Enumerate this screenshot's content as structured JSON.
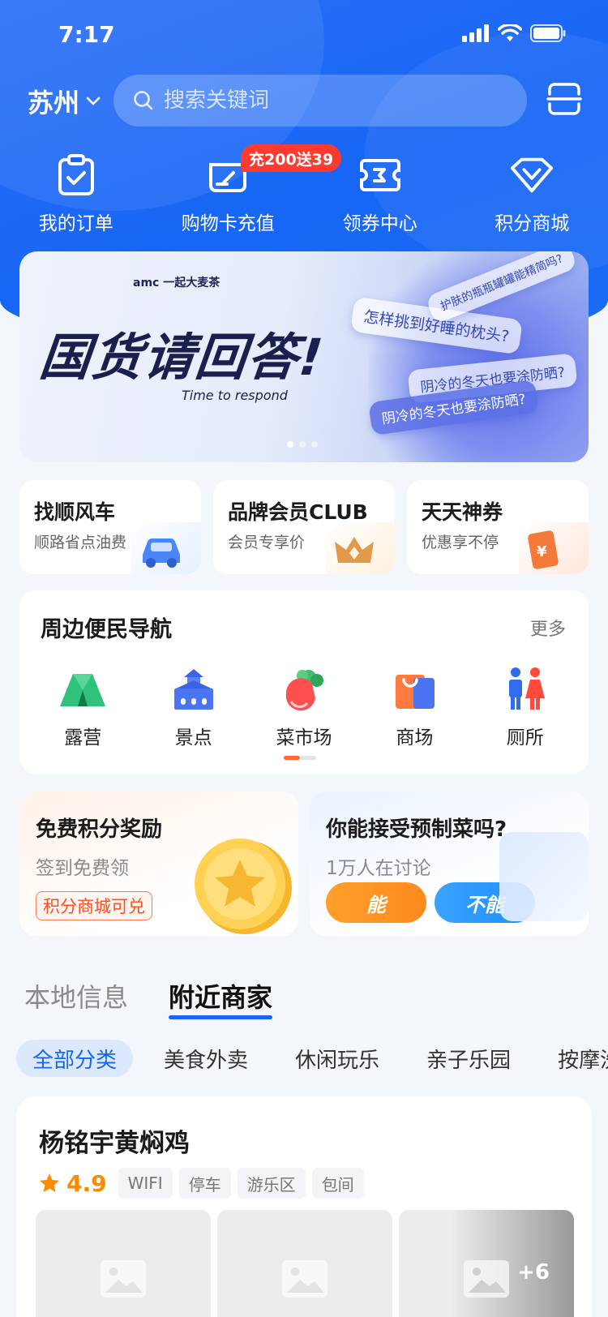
{
  "status_bar": {
    "time": "7:17"
  },
  "header": {
    "city": "苏州",
    "search_placeholder": "搜索关键词"
  },
  "quick_entries": [
    {
      "label": "我的订单",
      "icon": "order-icon"
    },
    {
      "label": "购物卡充值",
      "icon": "card-recharge-icon"
    },
    {
      "label": "领券中心",
      "icon": "coupon-icon"
    },
    {
      "label": "积分商城",
      "icon": "diamond-icon"
    }
  ],
  "recharge_badge": "充200送39",
  "banner": {
    "logo": "amc 一起大麦茶",
    "title": "国货请回答!",
    "subtitle": "Time to respond",
    "bubbles": [
      "怎样挑到好睡的枕头?",
      "阴冷的冬天也要涂防晒?",
      "阴冷的冬天也要涂防晒?",
      "护肤的瓶瓶罐罐能精简吗?"
    ],
    "page_count": 3,
    "active_page": 1
  },
  "feature_cards": [
    {
      "title": "找顺风车",
      "subtitle": "顺路省点油费",
      "icon": "car-icon",
      "accent": "#4a86f7"
    },
    {
      "title": "品牌会员CLUB",
      "subtitle": "会员专享价",
      "icon": "crown-icon",
      "accent": "#f5a13b"
    },
    {
      "title": "天天神券",
      "subtitle": "优惠享不停",
      "icon": "voucher-icon",
      "accent": "#f37a3a"
    }
  ],
  "nearby_nav": {
    "title": "周边便民导航",
    "more": "更多",
    "items": [
      {
        "label": "露营",
        "icon": "tent-icon"
      },
      {
        "label": "景点",
        "icon": "temple-icon"
      },
      {
        "label": "菜市场",
        "icon": "radish-icon"
      },
      {
        "label": "商场",
        "icon": "shopping-bag-icon"
      },
      {
        "label": "厕所",
        "icon": "restroom-icon"
      }
    ]
  },
  "points_card": {
    "title": "免费积分奖励",
    "subtitle": "签到免费领",
    "tag": "积分商城可兑"
  },
  "poll_card": {
    "title": "你能接受预制菜吗?",
    "subtitle": "1万人在讨论",
    "yes": "能",
    "no": "不能"
  },
  "tabs": [
    {
      "label": "本地信息",
      "active": false
    },
    {
      "label": "附近商家",
      "active": true
    }
  ],
  "categories": [
    {
      "label": "全部分类",
      "active": true
    },
    {
      "label": "美食外卖",
      "active": false
    },
    {
      "label": "休闲玩乐",
      "active": false
    },
    {
      "label": "亲子乐园",
      "active": false
    },
    {
      "label": "按摩洗",
      "active": false
    }
  ],
  "merchant": {
    "name": "杨铭宇黄焖鸡",
    "rating": "4.9",
    "tags": [
      "WIFI",
      "停车",
      "游乐区",
      "包间"
    ],
    "more_photos": "+6"
  },
  "colors": {
    "primary": "#1766f5",
    "badge": "#ff3b30",
    "rating": "#ff8a00"
  }
}
